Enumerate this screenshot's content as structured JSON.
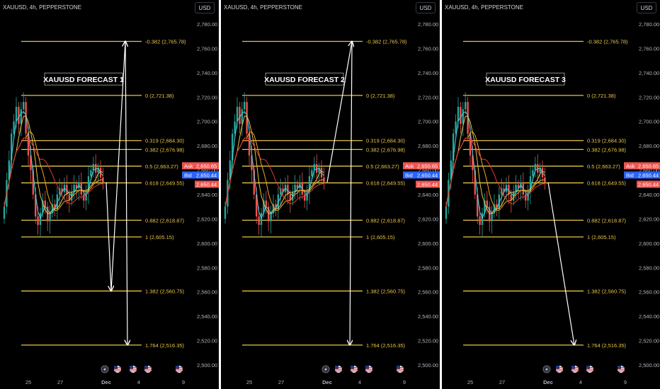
{
  "panels": [
    {
      "symbol": "XAUUSD, 4h, PEPPERSTONE",
      "currency": "USD",
      "title": "XAUUSD FORECAST 1",
      "ask": "2,650.65",
      "bid": "2,650.44",
      "price": "2,650.44",
      "ask_label": "Ask",
      "bid_label": "Bid",
      "show_tags": true,
      "scenario": "down-then-up"
    },
    {
      "symbol": "XAUUSD, 4h, PEPPERSTONE",
      "currency": "USD",
      "title": "XAUUSD FORECAST 2",
      "ask": "2,650.65",
      "bid": "2,650.44",
      "price": "2,650.44",
      "ask_label": "Ask",
      "bid_label": "Bid",
      "show_tags": true,
      "scenario": "up-then-down"
    },
    {
      "symbol": "XAUUSD, 4h, PEPPERSTONE",
      "currency": "USD",
      "title": "XAUUSD FORECAST 3",
      "ask": "2,650.65",
      "bid": "2,650.44",
      "price": "2,650.44",
      "ask_label": "Ask",
      "bid_label": "Bid",
      "show_tags": true,
      "scenario": "down"
    }
  ],
  "chart_data": {
    "type": "candlestick",
    "y_axis_labels": [
      "2,780.00",
      "2,760.00",
      "2,740.00",
      "2,720.00",
      "2,700.00",
      "2,680.00",
      "2,660.00",
      "2,640.00",
      "2,620.00",
      "2,600.00",
      "2,580.00",
      "2,560.00",
      "2,540.00",
      "2,520.00",
      "2,500.00"
    ],
    "ylim": [
      2495,
      2790
    ],
    "x_axis_labels": [
      "25",
      "27",
      "Dec",
      "4",
      "9"
    ],
    "fib_levels": [
      {
        "ratio": "-0.382",
        "price": 2765.78,
        "label": "-0.382 (2,765.78)"
      },
      {
        "ratio": "0",
        "price": 2721.38,
        "label": "0 (2,721.38)"
      },
      {
        "ratio": "0.319",
        "price": 2684.3,
        "label": "0.319 (2,684.30)"
      },
      {
        "ratio": "0.382",
        "price": 2676.98,
        "label": "0.382 (2,676.98)"
      },
      {
        "ratio": "0.5",
        "price": 2663.27,
        "label": "0.5 (2,663.27)"
      },
      {
        "ratio": "0.618",
        "price": 2649.55,
        "label": "0.618 (2,649.55)"
      },
      {
        "ratio": "0.882",
        "price": 2618.87,
        "label": "0.882 (2,618.87)"
      },
      {
        "ratio": "1",
        "price": 2605.15,
        "label": "1 (2,605.15)"
      },
      {
        "ratio": "1.382",
        "price": 2560.75,
        "label": "1.382 (2,560.75)"
      },
      {
        "ratio": "1.764",
        "price": 2516.35,
        "label": "1.764 (2,516.35)"
      }
    ],
    "closes": [
      2630,
      2652,
      2668,
      2690,
      2700,
      2712,
      2698,
      2710,
      2716,
      2690,
      2672,
      2660,
      2640,
      2622,
      2615,
      2625,
      2635,
      2630,
      2618,
      2625,
      2632,
      2628,
      2640,
      2645,
      2642,
      2648,
      2640,
      2635,
      2642,
      2648,
      2645,
      2650,
      2640,
      2635,
      2642,
      2655,
      2660,
      2665,
      2658,
      2662,
      2654,
      2650
    ]
  },
  "colors": {
    "fib": "#e8c547",
    "bull": "#26a69a",
    "bear": "#ef5350",
    "ma_red": "#e53935",
    "ma_orange": "#f5a623",
    "ma_yellow": "#e8c547",
    "ma_cyan": "#4dd0e1",
    "ask": "#ef5350",
    "bid": "#2962ff",
    "arrow": "#ffffff"
  },
  "icons": [
    "lightning-icon",
    "us-flag-icon",
    "us-flag-icon",
    "us-flag-icon",
    "us-flag-icon"
  ]
}
